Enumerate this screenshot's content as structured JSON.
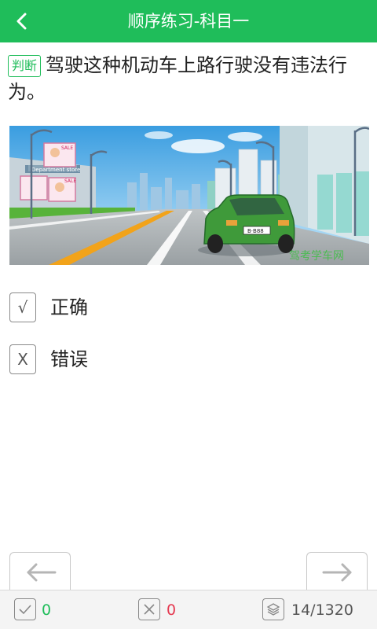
{
  "header": {
    "title": "顺序练习-科目一",
    "back_icon": "chevron-left-icon"
  },
  "question": {
    "tag": "判断",
    "text": "驾驶这种机动车上路行驶没有违法行为。",
    "image": {
      "description_icon": "street-scene-image",
      "signs": [
        "SALE",
        "SALE",
        "Department store"
      ],
      "watermark": "驾考学车网",
      "plate": "B·B88"
    }
  },
  "options": [
    {
      "mark": "√",
      "label": "正确"
    },
    {
      "mark": "X",
      "label": "错误"
    }
  ],
  "nav": {
    "prev_icon": "arrow-left-icon",
    "next_icon": "arrow-right-icon"
  },
  "status": {
    "correct_count": "0",
    "wrong_count": "0",
    "progress": "14/1320",
    "colors": {
      "correct": "#1fbd5a",
      "wrong": "#e53950",
      "accent": "#1fbd5a"
    }
  }
}
